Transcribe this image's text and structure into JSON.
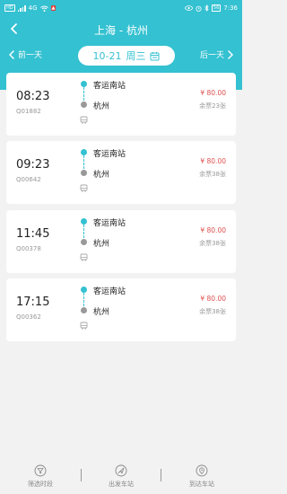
{
  "status_bar": {
    "left_text": "HD",
    "signal_label": "4G",
    "time": "7:36",
    "battery": "56"
  },
  "header": {
    "title": "上海 - 杭州",
    "prev_day": "前一天",
    "next_day": "后一天",
    "date": "10-21",
    "weekday": "周三"
  },
  "trips": [
    {
      "time": "08:23",
      "code": "Q01882",
      "from": "客运南站",
      "to": "杭州",
      "price": "¥ 80.00",
      "seats": "余票23张"
    },
    {
      "time": "09:23",
      "code": "Q00642",
      "from": "客运南站",
      "to": "杭州",
      "price": "¥ 80.00",
      "seats": "余票38张"
    },
    {
      "time": "11:45",
      "code": "Q00378",
      "from": "客运南站",
      "to": "杭州",
      "price": "¥ 80.00",
      "seats": "余票38张"
    },
    {
      "time": "17:15",
      "code": "Q00362",
      "from": "客运南站",
      "to": "杭州",
      "price": "¥ 80.00",
      "seats": "余票38张"
    }
  ],
  "bottom_bar": {
    "filter_time": "筛选时段",
    "departure_station": "出发车站",
    "arrival_station": "到达车站"
  },
  "colors": {
    "accent": "#34c1d1",
    "price": "#e05050"
  }
}
